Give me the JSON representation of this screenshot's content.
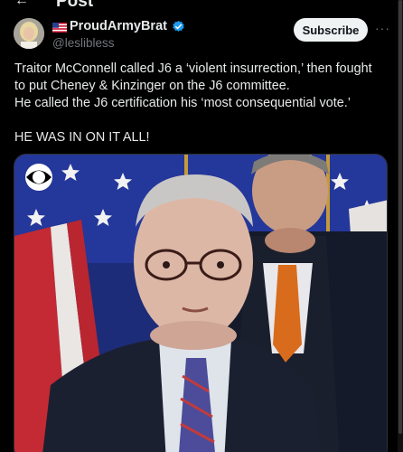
{
  "header": {
    "title": "Post",
    "back_icon": "arrow-left-icon"
  },
  "author": {
    "display_name": "ProudArmyBrat",
    "handle": "@leslibless",
    "flag_icon": "us-flag-icon",
    "verified_icon": "verified-badge-icon",
    "verified_color": "#1d9bf0"
  },
  "actions": {
    "subscribe_label": "Subscribe",
    "more_label": "···"
  },
  "tweet": {
    "lines": [
      "Traitor McConnell called J6 a ‘violent insurrection,’ then fought",
      "to put Cheney & Kinzinger on the J6 committee.",
      "He called the J6 certification his ‘most consequential vote.’",
      "",
      "HE WAS IN ON IT ALL!"
    ]
  },
  "media": {
    "type": "video-still",
    "watermark_icon": "cbs-eye-icon"
  }
}
